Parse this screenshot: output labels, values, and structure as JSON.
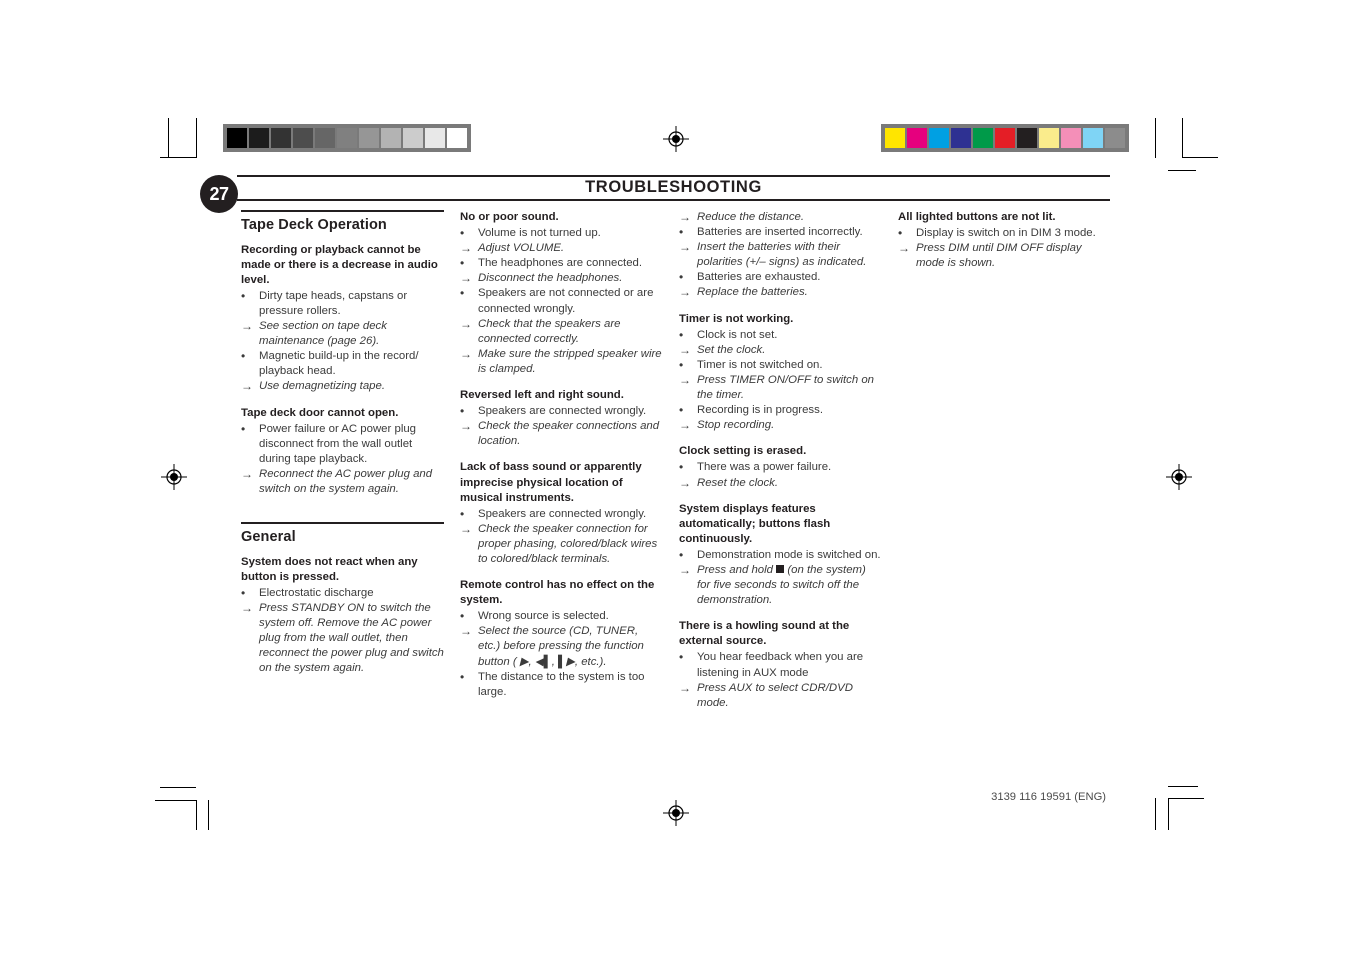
{
  "header": {
    "page_number": "27",
    "chapter_title": "TROUBLESHOOTING"
  },
  "footer": {
    "document_code": "3139 116 19591 (ENG)"
  },
  "marks": {
    "grayscale_swatches": [
      "#000000",
      "#1c1c1c",
      "#333333",
      "#4d4d4d",
      "#666666",
      "#808080",
      "#969696",
      "#b3b3b3",
      "#cccccc",
      "#e8e8e8",
      "#ffffff"
    ],
    "color_swatches": [
      "#ffe500",
      "#e6007e",
      "#00a0e3",
      "#2e3192",
      "#009a49",
      "#e41e26",
      "#231f20",
      "#faec8c",
      "#f48fb8",
      "#7fd4f5",
      "#8c8c8c"
    ]
  },
  "columns": [
    {
      "sections": [
        {
          "heading": "Tape Deck Operation",
          "blocks": [
            {
              "title": "Recording or playback cannot be made or there is a decrease in audio level.",
              "items": [
                {
                  "type": "cause",
                  "text": "Dirty tape heads, capstans or pressure rollers."
                },
                {
                  "type": "fix",
                  "text": "See section on tape deck maintenance (page 26)."
                },
                {
                  "type": "cause",
                  "text": "Magnetic build-up in the record/ playback head."
                },
                {
                  "type": "fix",
                  "text": "Use demagnetizing tape."
                }
              ]
            },
            {
              "title": "Tape deck door cannot open.",
              "items": [
                {
                  "type": "cause",
                  "text": "Power failure or AC power plug disconnect from the wall outlet during tape playback."
                },
                {
                  "type": "fix",
                  "text": "Reconnect the AC power plug and switch on the system again."
                }
              ]
            }
          ]
        },
        {
          "heading": "General",
          "blocks": [
            {
              "title": "System does not react when any button is pressed.",
              "items": [
                {
                  "type": "cause",
                  "text": "Electrostatic discharge"
                },
                {
                  "type": "fix",
                  "text": "Press STANDBY ON to switch the system off. Remove the AC power plug from the wall outlet, then reconnect the power plug and switch on the system again."
                }
              ]
            }
          ]
        }
      ]
    },
    {
      "sections": [
        {
          "heading": "",
          "blocks": [
            {
              "title": "No or poor sound.",
              "items": [
                {
                  "type": "cause",
                  "text": "Volume is not turned up."
                },
                {
                  "type": "fix",
                  "text": "Adjust VOLUME."
                },
                {
                  "type": "cause",
                  "text": "The headphones are connected."
                },
                {
                  "type": "fix",
                  "text": "Disconnect the headphones."
                },
                {
                  "type": "cause",
                  "text": "Speakers are not connected or are connected wrongly."
                },
                {
                  "type": "fix",
                  "text": "Check that the speakers are connected correctly."
                },
                {
                  "type": "fix",
                  "text": "Make sure the stripped speaker wire is clamped."
                }
              ]
            },
            {
              "title": "Reversed left and right sound.",
              "items": [
                {
                  "type": "cause",
                  "text": "Speakers are connected wrongly."
                },
                {
                  "type": "fix",
                  "text": "Check the speaker connections and location."
                }
              ]
            },
            {
              "title": "Lack of bass sound or apparently imprecise physical location of musical instruments.",
              "items": [
                {
                  "type": "cause",
                  "text": "Speakers are connected wrongly."
                },
                {
                  "type": "fix",
                  "text": "Check the speaker connection for proper phasing, colored/black wires to colored/black terminals."
                }
              ]
            },
            {
              "title": "Remote control has no effect on the system.",
              "items": [
                {
                  "type": "cause",
                  "text": "Wrong source is selected."
                },
                {
                  "type": "fix",
                  "text": "Select the source (CD, TUNER, etc.) before pressing the function button ( ▶, ◀▌, ▌▶, etc.)."
                },
                {
                  "type": "cause",
                  "text": "The distance to the system is too large."
                }
              ]
            }
          ]
        }
      ]
    },
    {
      "sections": [
        {
          "heading": "",
          "blocks": [
            {
              "title": "",
              "items": [
                {
                  "type": "fix",
                  "text": "Reduce the distance."
                },
                {
                  "type": "cause",
                  "text": "Batteries are inserted incorrectly."
                },
                {
                  "type": "fix",
                  "text": "Insert the batteries with their polarities (+/– signs) as indicated."
                },
                {
                  "type": "cause",
                  "text": "Batteries are exhausted."
                },
                {
                  "type": "fix",
                  "text": "Replace the batteries."
                }
              ]
            },
            {
              "title": "Timer is not working.",
              "items": [
                {
                  "type": "cause",
                  "text": "Clock is not set."
                },
                {
                  "type": "fix",
                  "text": "Set the clock."
                },
                {
                  "type": "cause",
                  "text": "Timer is not switched on."
                },
                {
                  "type": "fix",
                  "text": "Press TIMER ON/OFF to switch on the timer."
                },
                {
                  "type": "cause",
                  "text": "Recording is in progress."
                },
                {
                  "type": "fix",
                  "text": "Stop recording."
                }
              ]
            },
            {
              "title": "Clock setting is erased.",
              "items": [
                {
                  "type": "cause",
                  "text": "There was a power failure."
                },
                {
                  "type": "fix",
                  "text": "Reset the clock."
                }
              ]
            },
            {
              "title": "System displays features automatically; buttons flash continuously.",
              "items": [
                {
                  "type": "cause",
                  "text": "Demonstration mode is switched on."
                },
                {
                  "type": "fix",
                  "text": "Press and hold ■ (on the system) for five seconds to switch off the demonstration."
                }
              ]
            },
            {
              "title": "There is a howling sound at the external source.",
              "items": [
                {
                  "type": "cause",
                  "text": "You hear feedback when you are listening in AUX mode"
                },
                {
                  "type": "fix",
                  "text": "Press AUX to select CDR/DVD mode."
                }
              ]
            }
          ]
        }
      ]
    },
    {
      "sections": [
        {
          "heading": "",
          "blocks": [
            {
              "title": "All lighted buttons are not lit.",
              "items": [
                {
                  "type": "cause",
                  "text": "Display is switch on in DIM 3 mode."
                },
                {
                  "type": "fix",
                  "text": "Press DIM until DIM OFF display mode is shown."
                }
              ]
            }
          ]
        }
      ]
    }
  ],
  "bullets": {
    "cause_marker": "•",
    "fix_marker": "→"
  }
}
